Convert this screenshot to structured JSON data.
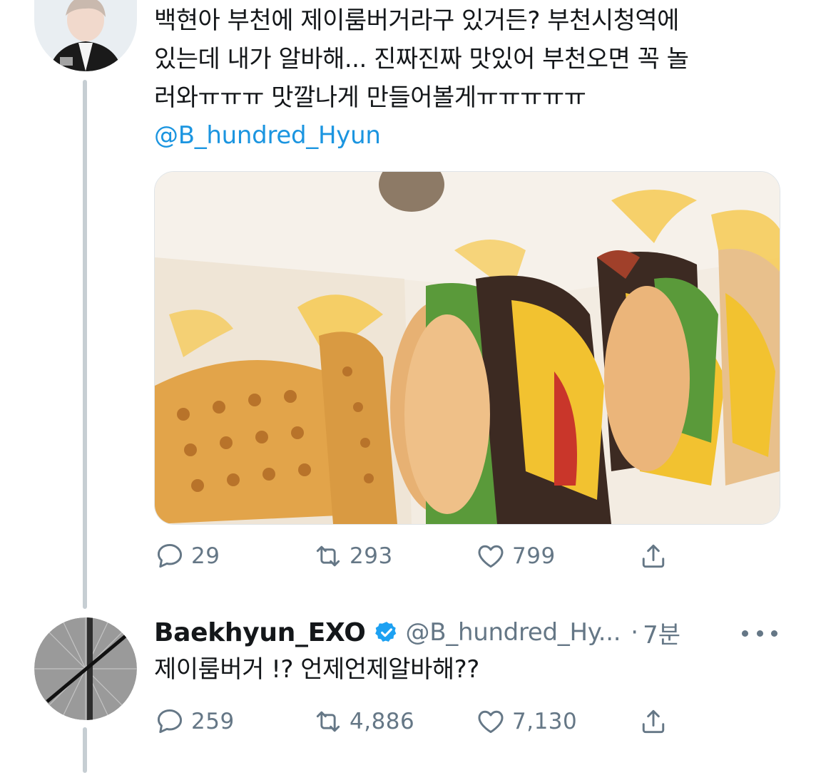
{
  "tweet1": {
    "text_lines": [
      "백현아 부천에 제이룸버거라구 있거든? 부천시청역에",
      "있는데 내가 알바해... 진짜진짜 맛있어 부천오면 꼭 놀",
      "러와ㅠㅠㅠ 맛깔나게 만들어볼게ㅠㅠㅠㅠㅠ"
    ],
    "mention": "@B_hundred_Hyun",
    "media_icon": "burger-photo",
    "actions": {
      "reply_count": "29",
      "retweet_count": "293",
      "like_count": "799"
    }
  },
  "tweet2": {
    "display_name": "Baekhyun_EXO",
    "handle": "@B_hundred_Hy...",
    "separator": "·",
    "time": "7분",
    "text": "제이룸버거 !? 언제언제알바해??",
    "actions": {
      "reply_count": "259",
      "retweet_count": "4,886",
      "like_count": "7,130"
    }
  },
  "colors": {
    "link": "#1b95e0",
    "secondary": "#657786",
    "thread_line": "#c6ced3",
    "verified": "#1da1f2"
  },
  "icons": [
    "reply-icon",
    "retweet-icon",
    "like-icon",
    "share-icon",
    "verified-badge-icon",
    "more-icon"
  ]
}
